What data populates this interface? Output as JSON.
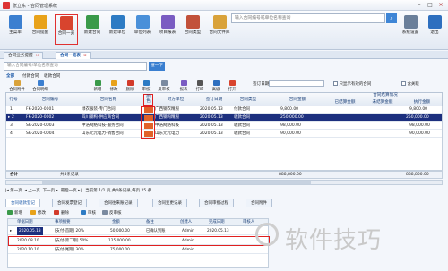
{
  "app": {
    "title": "张立东 - 合同管理系统"
  },
  "toolbar": {
    "buttons": [
      {
        "label": "主菜单",
        "icon": "home-icon",
        "color": "#3c7fd0"
      },
      {
        "label": "合同提醒",
        "icon": "bell-icon",
        "color": "#e8a21a"
      },
      {
        "label": "合同一览",
        "icon": "contract-list-icon",
        "color": "#d8442e"
      },
      {
        "label": "新建合同",
        "icon": "new-contract-icon",
        "color": "#3a9a4a"
      },
      {
        "label": "新建单位",
        "icon": "new-company-icon",
        "color": "#2d7bc4"
      },
      {
        "label": "单位列表",
        "icon": "company-list-icon",
        "color": "#4a90d9"
      },
      {
        "label": "项目报表",
        "icon": "report-icon",
        "color": "#7a5cc2"
      },
      {
        "label": "合同类型",
        "icon": "type-icon",
        "color": "#c2513a"
      },
      {
        "label": "合同文件库",
        "icon": "file-library-icon",
        "color": "#d9a23a"
      }
    ],
    "right_buttons": [
      {
        "label": "系统设置",
        "icon": "settings-icon"
      },
      {
        "label": "退出",
        "icon": "exit-icon"
      }
    ],
    "search_placeholder": "输入合同编号或单位名称查询"
  },
  "tabs": [
    {
      "label": "合同业务提醒",
      "active": false
    },
    {
      "label": "合同一览表",
      "active": true
    }
  ],
  "list": {
    "search_placeholder": "输入合同编号/单位名称查询",
    "search_button": "搜一下",
    "filters": [
      "全部",
      "付款合同",
      "收款合同"
    ],
    "actions": [
      "合同附件",
      "合同明细",
      "新增",
      "修改",
      "删除",
      "审核",
      "反审核",
      "报表",
      "打印",
      "高级",
      "打开"
    ],
    "date_label": "签订日期",
    "checkbox_label": "只显示有效的合同",
    "checkbox2_label": "含关联",
    "headers": {
      "idx": "行号",
      "code": "合同编号",
      "name": "合同名称",
      "color": "颜色",
      "party": "对方单位",
      "date": "签订日期",
      "type": "合同类型",
      "amount": "合同金额",
      "group": "合同结算情况",
      "paid": "已结算金额",
      "unpaid": "未结算金额",
      "exec": "执行金额"
    },
    "rows": [
      {
        "idx": "1",
        "code": "FK-2020-0001",
        "name": "绿衣服装-专门合同",
        "party": "广西钢衣精服",
        "date": "2020.05.13",
        "type": "付款合同",
        "amount": "9,800.00",
        "paid": "",
        "unpaid": "",
        "exec": "9,800.00"
      },
      {
        "idx": "2",
        "code": "FK-2020-0002",
        "name": "四川钢构-供应商合同",
        "party": "广西钢构精服",
        "date": "2020.05.13",
        "type": "收款合同",
        "amount": "250,000.00",
        "paid": "",
        "unpaid": "",
        "exec": "250,000.00"
      },
      {
        "idx": "3",
        "code": "SK-2020-0003",
        "name": "中浩网络科技-服务合同",
        "party": "中浩网络科技",
        "date": "2020.05.13",
        "type": "收款合同",
        "amount": "98,000.00",
        "paid": "",
        "unpaid": "",
        "exec": "98,000.00"
      },
      {
        "idx": "4",
        "code": "SK-2020-0004",
        "name": "山东元元电力-销售合同",
        "party": "山东元元电力",
        "date": "2020.05.13",
        "type": "收款合同",
        "amount": "90,000.00",
        "paid": "",
        "unpaid": "",
        "exec": "90,000.00"
      }
    ],
    "selected_row": 2,
    "total_label": "合计",
    "total_count": "共4条记录",
    "total_amount": "888,800.00",
    "total_exec": "888,800.00",
    "pager": {
      "first": "第一页",
      "prev": "上一页",
      "next": "下一页",
      "last": "最后一页",
      "info": "当前第 1/1 页,共4条记录,每页 25 条"
    }
  },
  "detail": {
    "tabs": [
      "合同收款登记",
      "合同发票登记",
      "合同往来账记录",
      "合同变更记录",
      "合同审批过程",
      "合同附件"
    ],
    "actions": [
      "新增",
      "修改",
      "删除",
      "审核",
      "反审核"
    ],
    "headers": [
      "单据日期",
      "事项摘要",
      "金额",
      "备注",
      "创建人",
      "完成日期",
      "审核人"
    ],
    "rows": [
      {
        "date": "2020.05.13",
        "summary": "[支付-首期] 20%",
        "amount": "50,000.00",
        "note": "已确认到账",
        "creator": "Admin",
        "done": "2020.05.13",
        "auditor": ""
      },
      {
        "date": "2020.08.10",
        "summary": "[支付-第二期] 50%",
        "amount": "125,000.00",
        "note": "",
        "creator": "Admin",
        "done": "",
        "auditor": ""
      },
      {
        "date": "2020.10.10",
        "summary": "[支付-尾期] 30%",
        "amount": "75,000.00",
        "note": "",
        "creator": "Admin",
        "done": "",
        "auditor": ""
      }
    ]
  },
  "watermark": "软件技巧"
}
